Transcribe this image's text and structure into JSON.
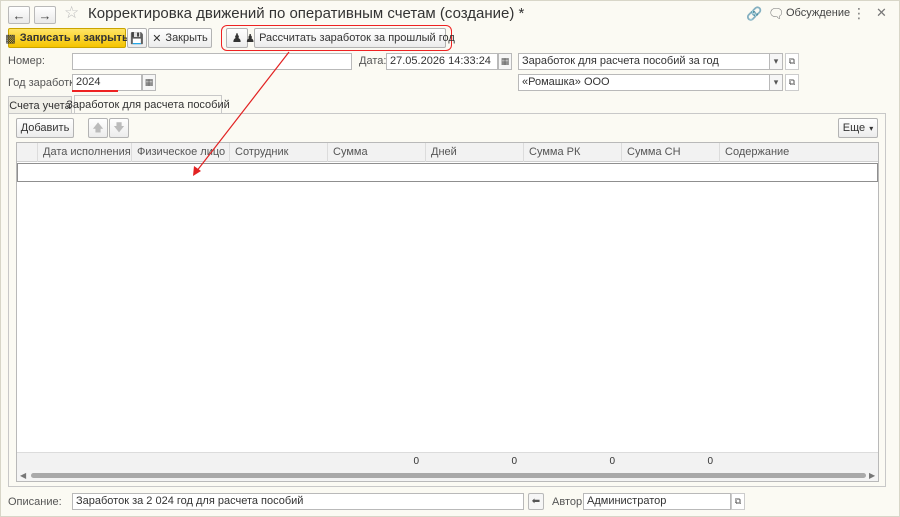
{
  "window": {
    "title": "Корректировка движений по оперативным счетам (создание) *",
    "discuss_label": "Обсуждение"
  },
  "toolbar": {
    "save_close_label": "Записать и закрыть",
    "close_label": "Закрыть",
    "calc_label": "Рассчитать заработок за прошлый год"
  },
  "form": {
    "number_label": "Номер:",
    "number_value": "",
    "date_label": "Дата:",
    "date_value": "27.05.2026 14:33:24",
    "type_value": "Заработок для расчета пособий за год",
    "year_label": "Год заработка:",
    "year_value": "2024",
    "org_value": "«Ромашка» ООО"
  },
  "tabs": [
    {
      "label": "Счета учета",
      "active": false
    },
    {
      "label": "Заработок для расчета пособий",
      "active": true
    }
  ],
  "table_toolbar": {
    "add_label": "Добавить",
    "more_label": "Еще"
  },
  "table": {
    "columns": [
      "Дата исполнения",
      "Физическое лицо",
      "Сотрудник",
      "Сумма",
      "Дней",
      "Сумма РК",
      "Сумма СН",
      "Содержание"
    ],
    "rows": [],
    "totals": {
      "sum": "0",
      "days": "0",
      "sum_rk": "0",
      "sum_sn": "0"
    }
  },
  "footer": {
    "description_label": "Описание:",
    "description_value": "Заработок за 2 024 год для расчета пособий",
    "author_label": "Автор:",
    "author_value": "Администратор"
  },
  "colors": {
    "accent_yellow": "#f5c400",
    "annotation_red": "#e22222"
  }
}
